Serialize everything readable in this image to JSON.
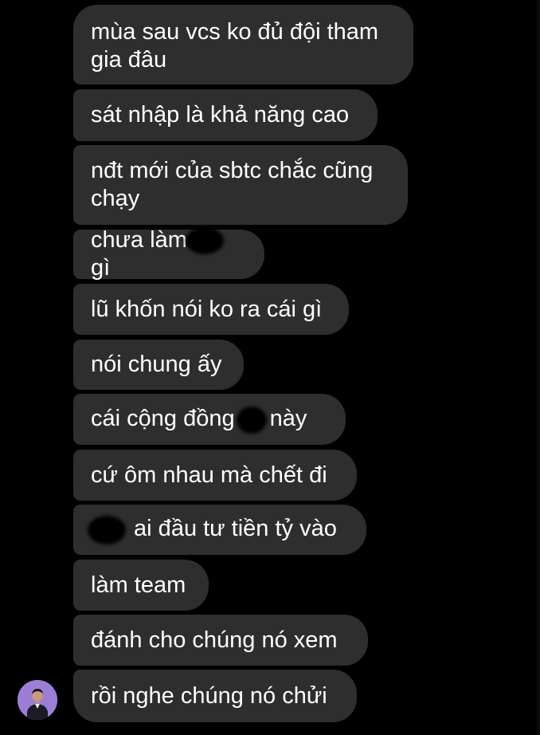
{
  "colors": {
    "background": "#000000",
    "bubble": "#2e2e2e",
    "text": "#ffffff",
    "avatar_bg": "#9c7ed6"
  },
  "messages": [
    "mùa sau vcs ko đủ đội tham gia đâu",
    "sát nhập là khả năng cao",
    "nđt mới của sbtc chắc cũng chạy",
    {
      "before": "chưa làm",
      "after": " gì"
    },
    "lũ khốn nói ko ra cái gì",
    "nói chung ấy",
    {
      "before": "cái cộng đồng",
      "after": " này"
    },
    "cứ ôm nhau mà chết đi",
    {
      "before": "",
      "after": " ai đầu tư tiền tỷ vào"
    },
    "làm team",
    "đánh cho chúng nó xem",
    "rồi nghe chúng nó chửi"
  ],
  "avatar": {
    "icon": "person-avatar-icon"
  }
}
